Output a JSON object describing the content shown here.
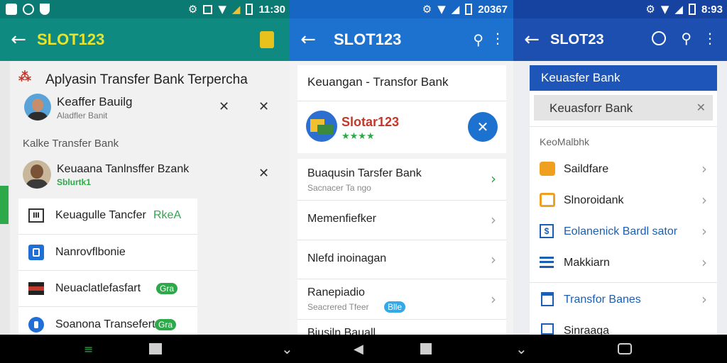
{
  "panel1": {
    "status": {
      "time": "11:30"
    },
    "app_title": "SLOT123",
    "heading": "Aplyasin Transfer Bank Terpercha",
    "recent1": {
      "name": "Keaffer Bauilg",
      "sub": "Aladfler Banit"
    },
    "section_label": "Kalke Transfer Bank",
    "recent2": {
      "name": "Keuaana Tanlnsffer Bzank",
      "sub": "Sblurtk1"
    },
    "list": [
      {
        "label": "Keuagulle Tancfer",
        "tag": "RkeA",
        "icon": "bank-building-icon"
      },
      {
        "label": "Nanrovflbonie",
        "icon": "mobile-icon"
      },
      {
        "label": "Neuaclatlefasfart",
        "tag": "Gra",
        "icon": "flag-icon"
      },
      {
        "label": "Soanona Transefert",
        "tag": "Gra",
        "icon": "shield-icon"
      }
    ]
  },
  "panel2": {
    "status": {
      "time": "20367"
    },
    "app_title": "SLOT123",
    "header_card_title": "Keuangan - Transfor Bank",
    "app_name": "Slotar123",
    "rating": "★★★★",
    "list": [
      {
        "label": "Buaqusin Tarsfer Bank",
        "sub": "Sacnacer Ta ngo"
      },
      {
        "label": "Memenfiefker"
      },
      {
        "label": "Nlefd inoinagan"
      },
      {
        "label": "Ranepiadio",
        "sub": "Seacrered Tfeer",
        "tag": "Blle"
      },
      {
        "label": "Biusiln Bauall"
      }
    ]
  },
  "panel3": {
    "status": {
      "time": "8:93"
    },
    "app_title": "SLOT23",
    "card_header": "Keuasfer Bank",
    "search_value": "Keuasforr Bank",
    "section_label": "KeoMalbhk",
    "list": [
      {
        "label": "Saildfare",
        "color": "#222222",
        "icon": "wallet-icon"
      },
      {
        "label": "Slnoroidank",
        "color": "#222222",
        "icon": "bank-card-icon"
      },
      {
        "label": "Eolanenick Bardl sator",
        "color": "#1a5fb4",
        "icon": "dollar-icon"
      },
      {
        "label": "Makkiarn",
        "color": "#222222",
        "icon": "menu-lines-icon"
      },
      {
        "label": "Transfor Banes",
        "color": "#1a5fb4",
        "icon": "bank-icon"
      },
      {
        "label": "Sinraaga",
        "color": "#222222",
        "icon": "card-icon"
      }
    ]
  },
  "colors": {
    "teal_bar": "#0f8a80",
    "title_yellow": "#e8e32c",
    "blue_bar": "#1d72d0",
    "dark_blue_bar": "#1c4fb0",
    "green_tag": "#2ea94a",
    "blue_tag": "#33a9e8"
  }
}
